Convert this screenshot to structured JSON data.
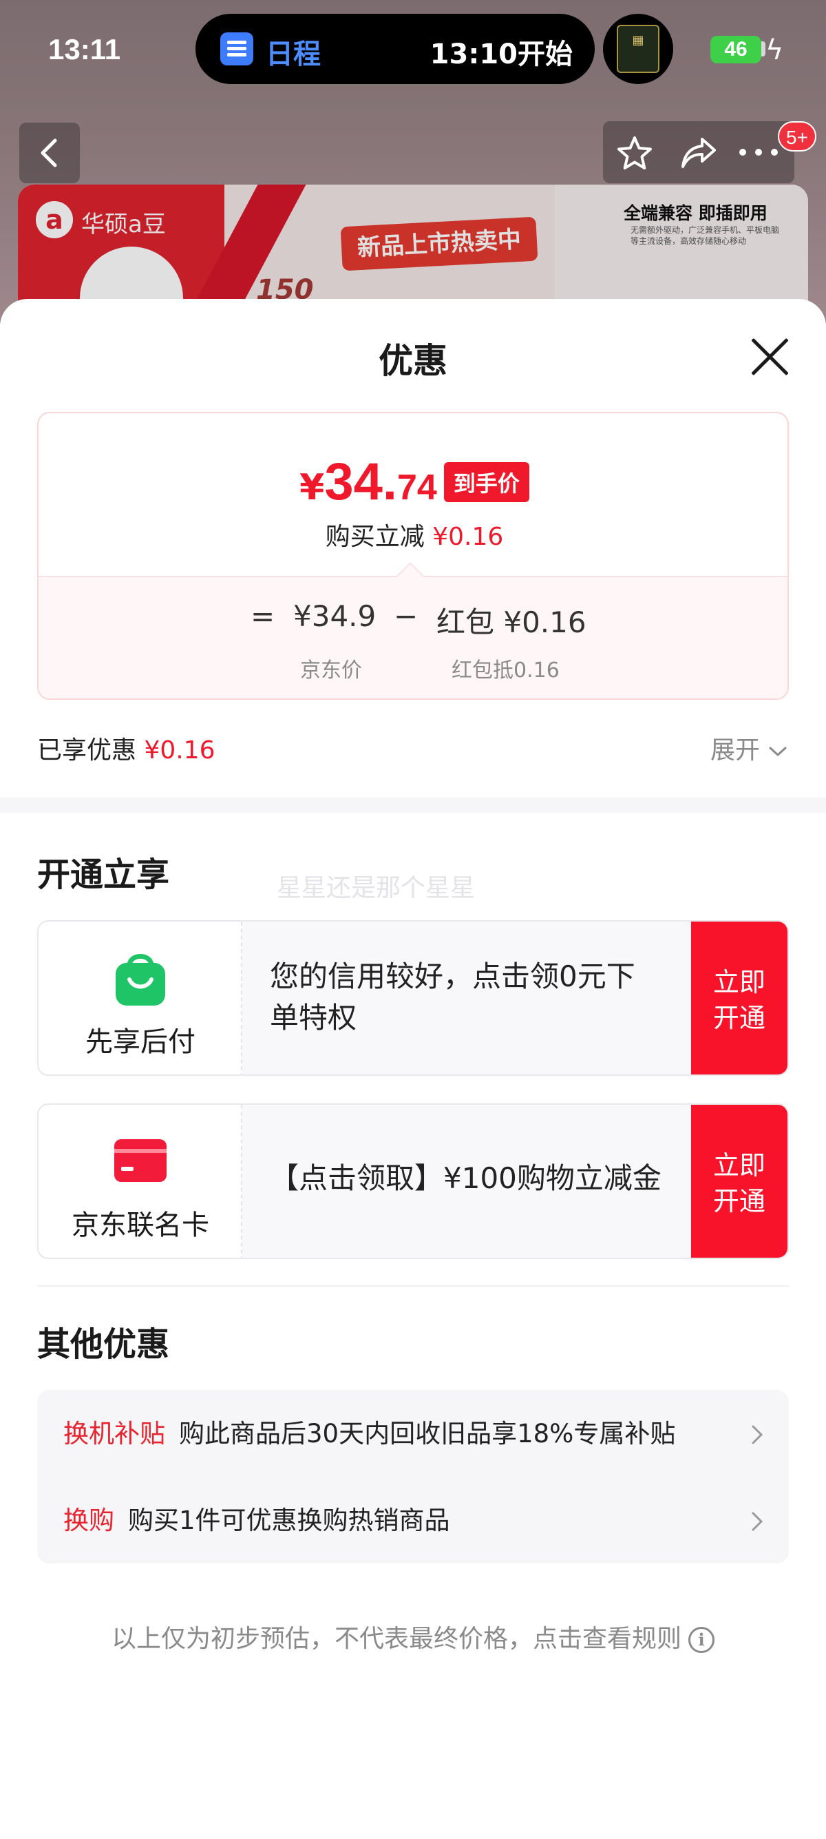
{
  "status_bar": {
    "time": "13:11",
    "island_app": "日程",
    "island_event": "13:10开始",
    "battery": "46"
  },
  "nav": {
    "badge": "5+"
  },
  "banner": {
    "brand": "华硕a豆",
    "slogan": "新品上市热卖中",
    "speed": "150",
    "compat_title": "全端兼容 即插即用",
    "compat_detail": "无需额外驱动，广泛兼容手机、平板电脑等主流设备，高效存储随心移动"
  },
  "sheet": {
    "title": "优惠",
    "close_icon": "close-icon"
  },
  "price_card": {
    "currency": "¥",
    "price_int": "34.",
    "price_dec": "74",
    "price_tag": "到手价",
    "instant_label": "购买立减",
    "instant_value": "¥0.16",
    "eq_sign": "=",
    "jd_price": "¥34.9",
    "minus_sign": "−",
    "hongbao": "红包 ¥0.16",
    "jd_price_label": "京东价",
    "hongbao_label": "红包抵0.16"
  },
  "enjoyed": {
    "label": "已享优惠",
    "value": "¥0.16",
    "expand": "展开"
  },
  "open_section": {
    "title": "开通立享",
    "watermark": "星星还是那个星星",
    "offers": [
      {
        "name": "先享后付",
        "desc": "您的信用较好，点击领0元下单特权",
        "button": "立即\n开通",
        "icon": "shopping-bag-icon"
      },
      {
        "name": "京东联名卡",
        "desc": "【点击领取】¥100购物立减金",
        "button": "立即\n开通",
        "icon": "credit-card-icon"
      }
    ]
  },
  "other_section": {
    "title": "其他优惠",
    "items": [
      {
        "tag": "换机补贴",
        "text": "购此商品后30天内回收旧品享18%专属补贴"
      },
      {
        "tag": "换购",
        "text": "购买1件可优惠换购热销商品"
      }
    ]
  },
  "footer": {
    "note": "以上仅为初步预估，不代表最终价格，点击查看规则"
  },
  "colors": {
    "accent_red": "#f0192b",
    "button_red": "#f8132a",
    "green_bag": "#1ec466"
  }
}
